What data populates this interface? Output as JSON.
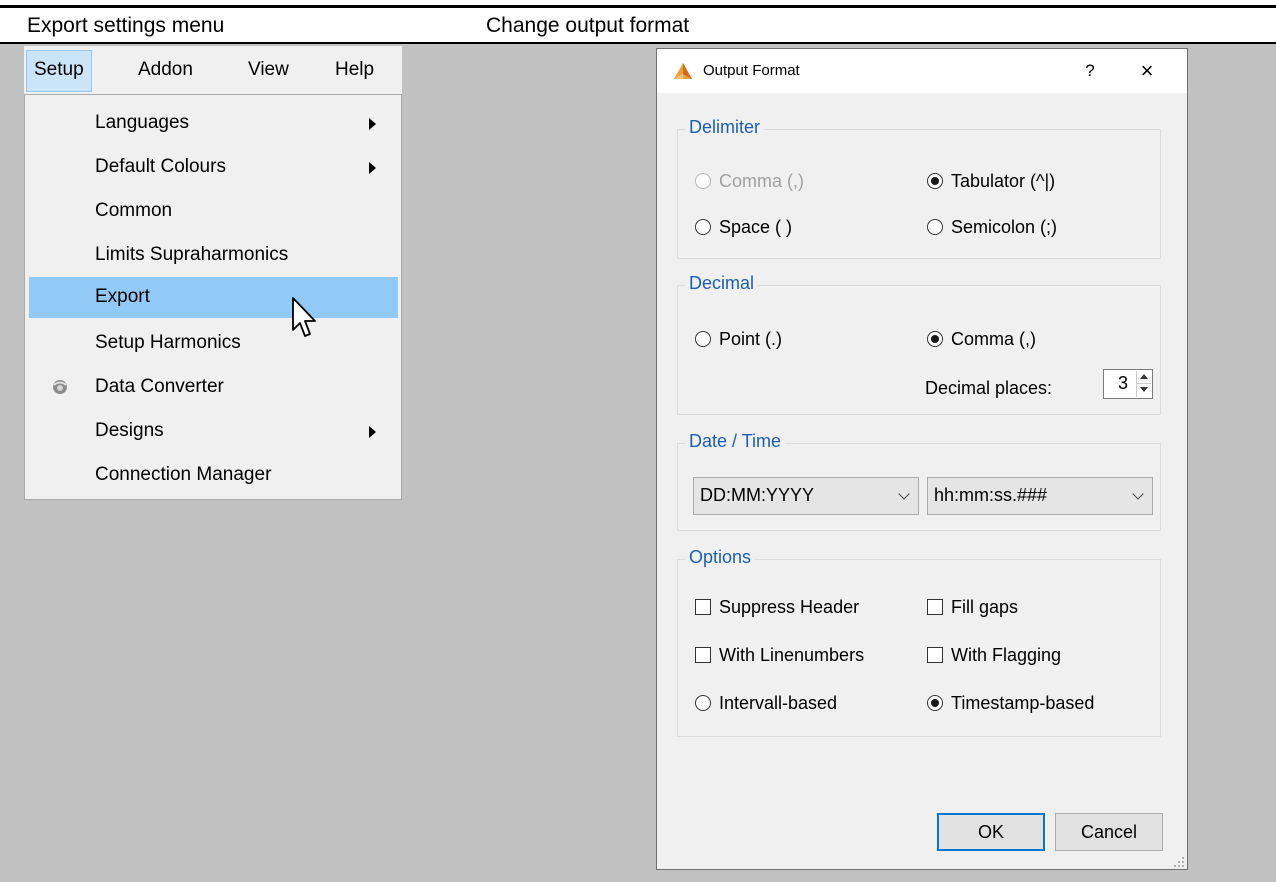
{
  "captions": {
    "left": "Export settings menu",
    "right": "Change output format"
  },
  "menubar": {
    "items": [
      "Setup",
      "Addon",
      "View",
      "Help"
    ],
    "active": "Setup"
  },
  "menu": {
    "items": [
      {
        "label": "Languages",
        "submenu": true
      },
      {
        "label": "Default Colours",
        "submenu": true
      },
      {
        "label": "Common",
        "submenu": false
      },
      {
        "label": "Limits Supraharmonics",
        "submenu": false
      },
      {
        "label": "Export",
        "submenu": false,
        "highlighted": true
      },
      {
        "label": "Setup Harmonics",
        "submenu": false
      },
      {
        "label": "Data Converter",
        "submenu": false,
        "icon": "data-converter-icon"
      },
      {
        "label": "Designs",
        "submenu": true
      },
      {
        "label": "Connection Manager",
        "submenu": false
      }
    ]
  },
  "dialog": {
    "title": "Output Format",
    "help": "?",
    "close": "×",
    "delimiter": {
      "title": "Delimiter",
      "comma": "Comma (,)",
      "tabulator": "Tabulator (^|)",
      "space": "Space ( )",
      "semicolon": "Semicolon (;)",
      "selected": "Tabulator (^|)"
    },
    "decimal": {
      "title": "Decimal",
      "point": "Point (.)",
      "comma": "Comma (,)",
      "selected": "Comma (,)",
      "places_label": "Decimal places:",
      "places_value": "3"
    },
    "datetime": {
      "title": "Date / Time",
      "date_format": "DD:MM:YYYY",
      "time_format": "hh:mm:ss.###"
    },
    "options": {
      "title": "Options",
      "suppress_header": "Suppress Header",
      "fill_gaps": "Fill gaps",
      "with_linenumbers": "With Linenumbers",
      "with_flagging": "With Flagging",
      "intervall_based": "Intervall-based",
      "timestamp_based": "Timestamp-based",
      "selected": "Timestamp-based"
    },
    "ok_label": "OK",
    "cancel_label": "Cancel"
  },
  "colors": {
    "accent": "#0078d7",
    "group_title": "#1c5fb0",
    "menu_highlight": "#91c9f7",
    "background": "#c1c1c1"
  }
}
